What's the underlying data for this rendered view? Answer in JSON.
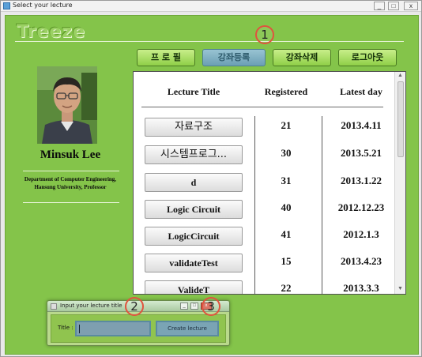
{
  "window": {
    "title": "Select your lecture"
  },
  "brand": "Treeze",
  "nav": [
    {
      "label": "프 로 필",
      "active": false
    },
    {
      "label": "강좌등록",
      "active": true
    },
    {
      "label": "강좌삭제",
      "active": false
    },
    {
      "label": "로그아웃",
      "active": false
    }
  ],
  "markers": [
    "1",
    "2",
    "3"
  ],
  "profile": {
    "name": "Minsuk Lee",
    "department_line1": "Department of Computer Engineering,",
    "department_line2": "Hansung University, Professor"
  },
  "table": {
    "headers": [
      "Lecture Title",
      "Registered",
      "Latest day"
    ],
    "rows": [
      {
        "title": "자료구조",
        "registered": "21",
        "latest": "2013.4.11"
      },
      {
        "title": "시스템프로그...",
        "registered": "30",
        "latest": "2013.5.21"
      },
      {
        "title": "d",
        "registered": "31",
        "latest": "2013.1.22"
      },
      {
        "title": "Logic Circuit",
        "registered": "40",
        "latest": "2012.12.23"
      },
      {
        "title": "LogicCircuit",
        "registered": "41",
        "latest": "2012.1.3"
      },
      {
        "title": "validateTest",
        "registered": "15",
        "latest": "2013.4.23"
      },
      {
        "title": "ValideT",
        "registered": "22",
        "latest": "2013.3.3"
      }
    ]
  },
  "dialog": {
    "title": "Input your lecture title",
    "field_label": "Title :",
    "field_value": "",
    "button_label": "Create lecture"
  },
  "colors": {
    "background": "#84c44a",
    "nav_button": "#a8de63",
    "nav_button_active": "#7fabbd",
    "marker_ring": "#e0533e"
  },
  "icons": {
    "app": "java-app-icon",
    "minimize": "minimize-icon",
    "maximize": "maximize-icon",
    "close": "close-icon"
  }
}
